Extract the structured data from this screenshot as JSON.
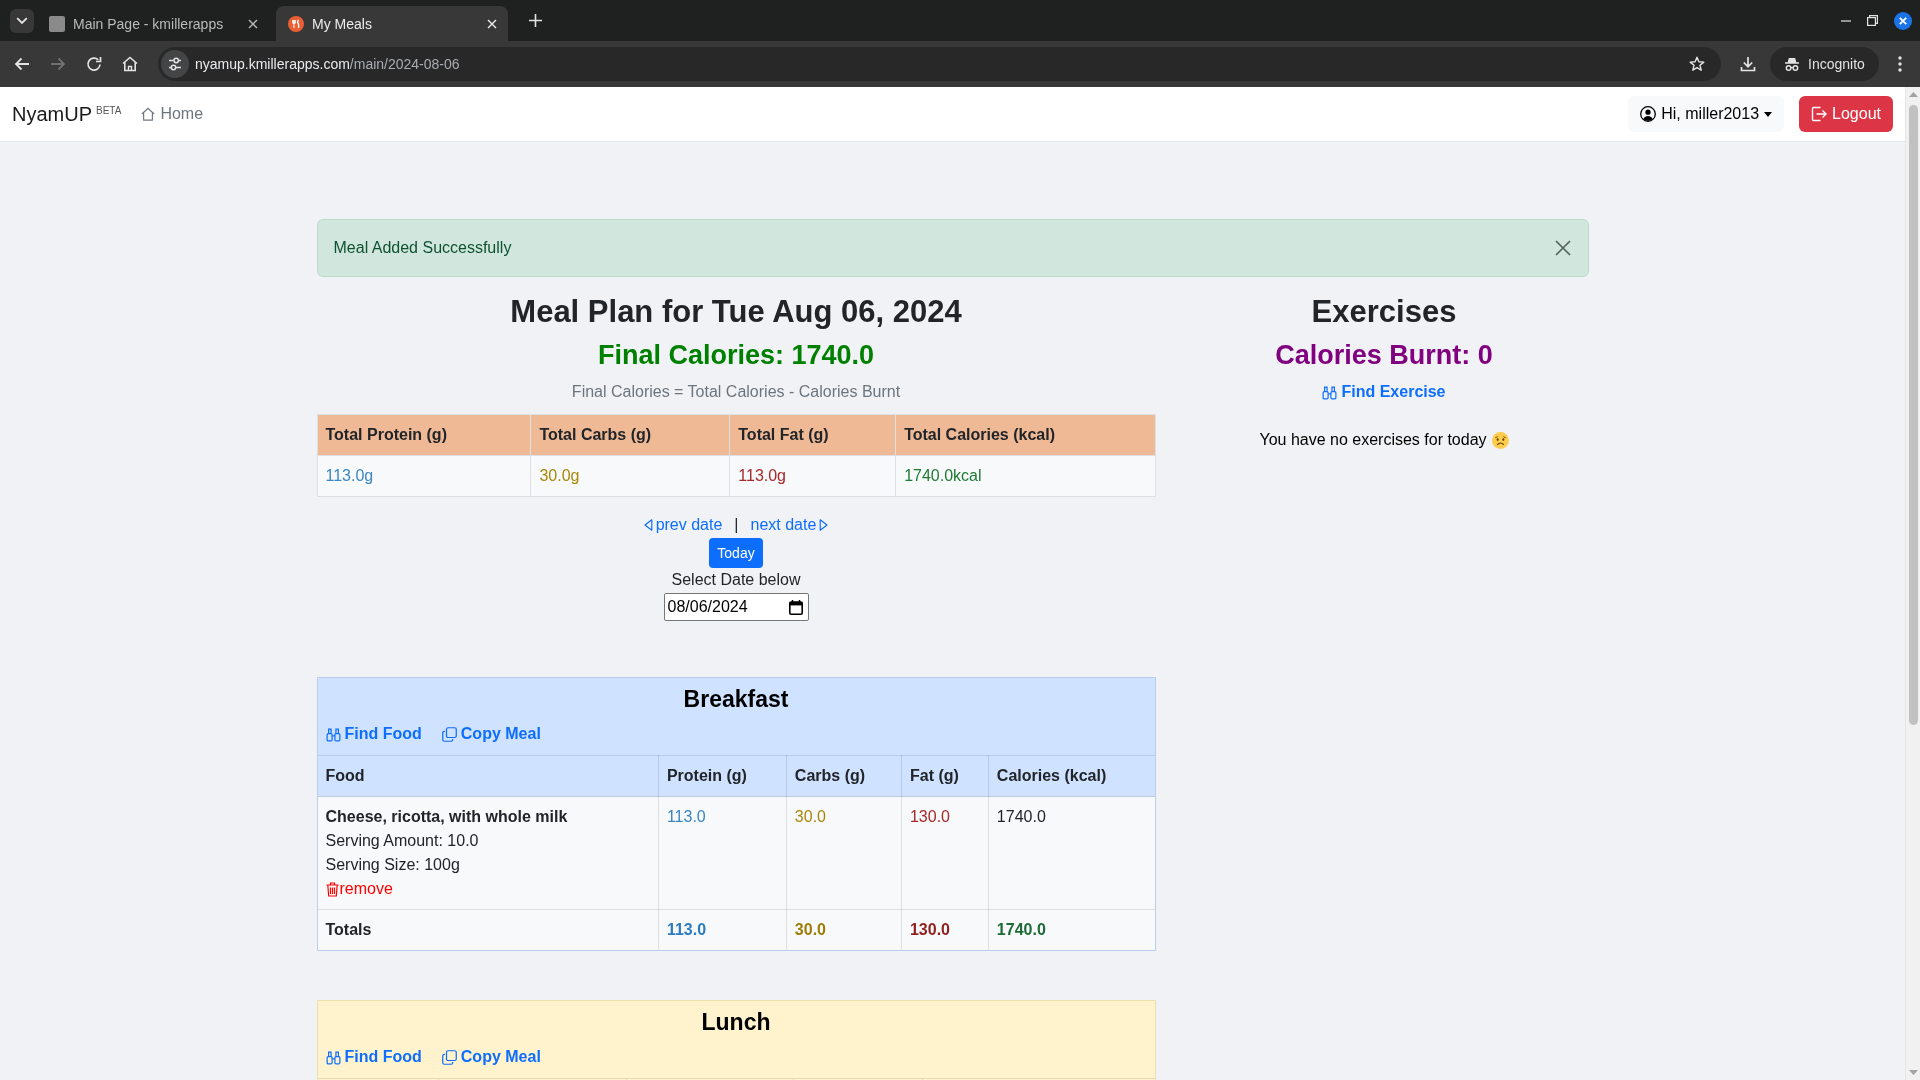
{
  "browser": {
    "tabs": [
      {
        "title": "Main Page - kmillerapps",
        "kind": "photo",
        "selected": false
      },
      {
        "title": "My Meals",
        "kind": "meals",
        "selected": true
      }
    ],
    "forward_disabled": true,
    "url_host": "nyamup.kmillerapps.com",
    "url_path": "/main/2024-08-06",
    "profile": "Incognito"
  },
  "navbar": {
    "brand": "NyamUP",
    "badge": "BETA",
    "home": "Home",
    "user": "Hi, miller2013",
    "logout": "Logout"
  },
  "alert": {
    "message": "Meal Added Successfully"
  },
  "meal_plan": {
    "title": "Meal Plan for Tue Aug 06, 2024",
    "final_calories": "Final Calories: 1740.0",
    "formula": "Final Calories = Total Calories - Calories Burnt",
    "summary": [
      {
        "label": "Total Protein (g)",
        "value": "113.0g",
        "color": "#3a87c4"
      },
      {
        "label": "Total Carbs (g)",
        "value": "30.0g",
        "color": "#a8870a"
      },
      {
        "label": "Total Fat (g)",
        "value": "113.0g",
        "color": "#a52a2a"
      },
      {
        "label": "Total Calories (kcal)",
        "value": "1740.0kcal",
        "color": "#1e7b34"
      }
    ],
    "date_nav": {
      "prev": "prev date",
      "separator": "|",
      "next": "next date",
      "today": "Today",
      "select_label": "Select Date below",
      "date": "08/06/2024"
    }
  },
  "meals": [
    {
      "title": "Breakfast",
      "kind": "breakfast",
      "links": [
        {
          "label": "Find Food",
          "kind": "find"
        },
        {
          "label": "Copy Meal",
          "kind": "copy"
        }
      ],
      "columns": [
        "Food",
        "Protein (g)",
        "Carbs (g)",
        "Fat (g)",
        "Calories (kcal)"
      ],
      "items": [
        {
          "name": "Cheese, ricotta, with whole milk",
          "serving_amount": "Serving Amount: 10.0",
          "serving_size": "Serving Size: 100g",
          "remove": "remove",
          "values": [
            {
              "text": "113.0",
              "color": "#3a87c4"
            },
            {
              "text": "30.0",
              "color": "#a8870a"
            },
            {
              "text": "130.0",
              "color": "#a52a2a"
            },
            {
              "text": "1740.0",
              "color": "#212529"
            }
          ]
        }
      ],
      "totals": {
        "label": "Totals",
        "values": [
          {
            "text": "113.0",
            "color": "#2b7bbf"
          },
          {
            "text": "30.0",
            "color": "#9e7d06"
          },
          {
            "text": "130.0",
            "color": "#8f1f1f"
          },
          {
            "text": "1740.0",
            "color": "#1d6b36"
          }
        ]
      }
    },
    {
      "title": "Lunch",
      "kind": "lunch",
      "links": [
        {
          "label": "Find Food",
          "kind": "find"
        },
        {
          "label": "Copy Meal",
          "kind": "copy"
        }
      ]
    }
  ],
  "exercises": {
    "title": "Exercises",
    "calories_burnt": "Calories Burnt: 0",
    "find": "Find Exercise",
    "empty_message": "You have no exercises for today"
  }
}
